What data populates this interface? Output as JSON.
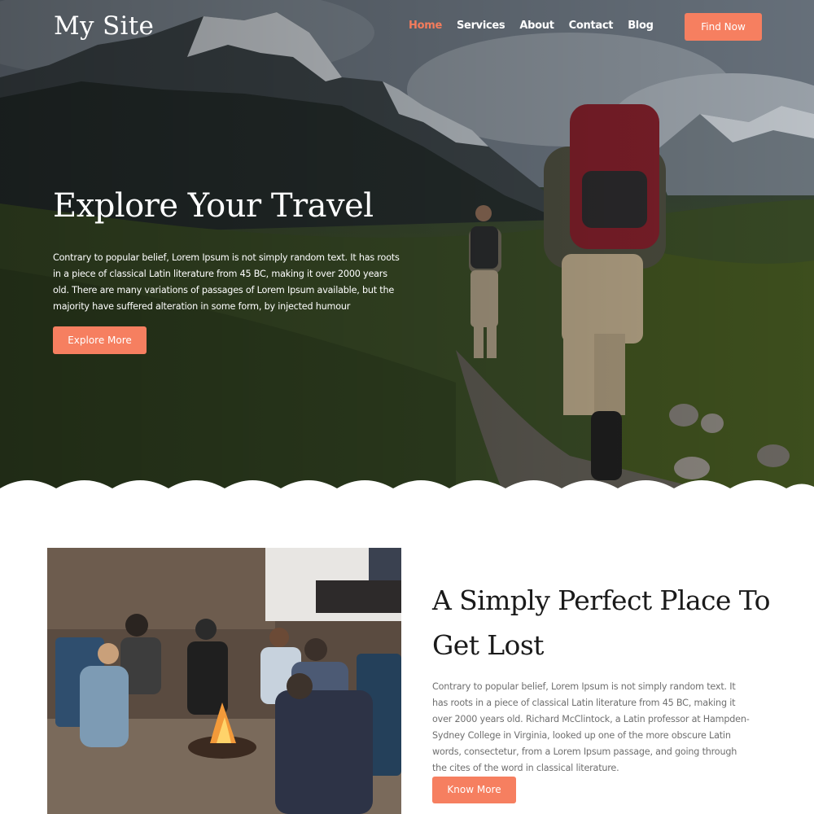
{
  "header": {
    "logo": "My Site",
    "nav": [
      {
        "label": "Home",
        "active": true
      },
      {
        "label": "Services",
        "active": false
      },
      {
        "label": "About",
        "active": false
      },
      {
        "label": "Contact",
        "active": false
      },
      {
        "label": "Blog",
        "active": false
      }
    ],
    "cta_label": "Find Now"
  },
  "hero": {
    "title": "Explore Your Travel",
    "text": "Contrary to popular belief, Lorem Ipsum is not simply random text. It has roots in a piece of classical Latin literature from 45 BC, making it over 2000 years old. There are many variations of passages of Lorem Ipsum available, but the majority have suffered alteration in some form, by injected humour",
    "button_label": "Explore More"
  },
  "about": {
    "title": "A Simply Perfect Place To Get Lost",
    "text": "Contrary to popular belief, Lorem Ipsum is not simply random text. It has roots in a piece of classical Latin literature from 45 BC, making it over 2000 years old. Richard McClintock, a Latin professor at Hampden-Sydney College in Virginia, looked up one of the more obscure Latin words, consectetur, from a Lorem Ipsum passage, and going through the cites of the word in classical literature.",
    "button_label": "Know More"
  },
  "colors": {
    "accent": "#f67f60",
    "nav_active": "#f47c5c",
    "heading": "#1a1a1a",
    "body_text": "#6f6f6f"
  }
}
